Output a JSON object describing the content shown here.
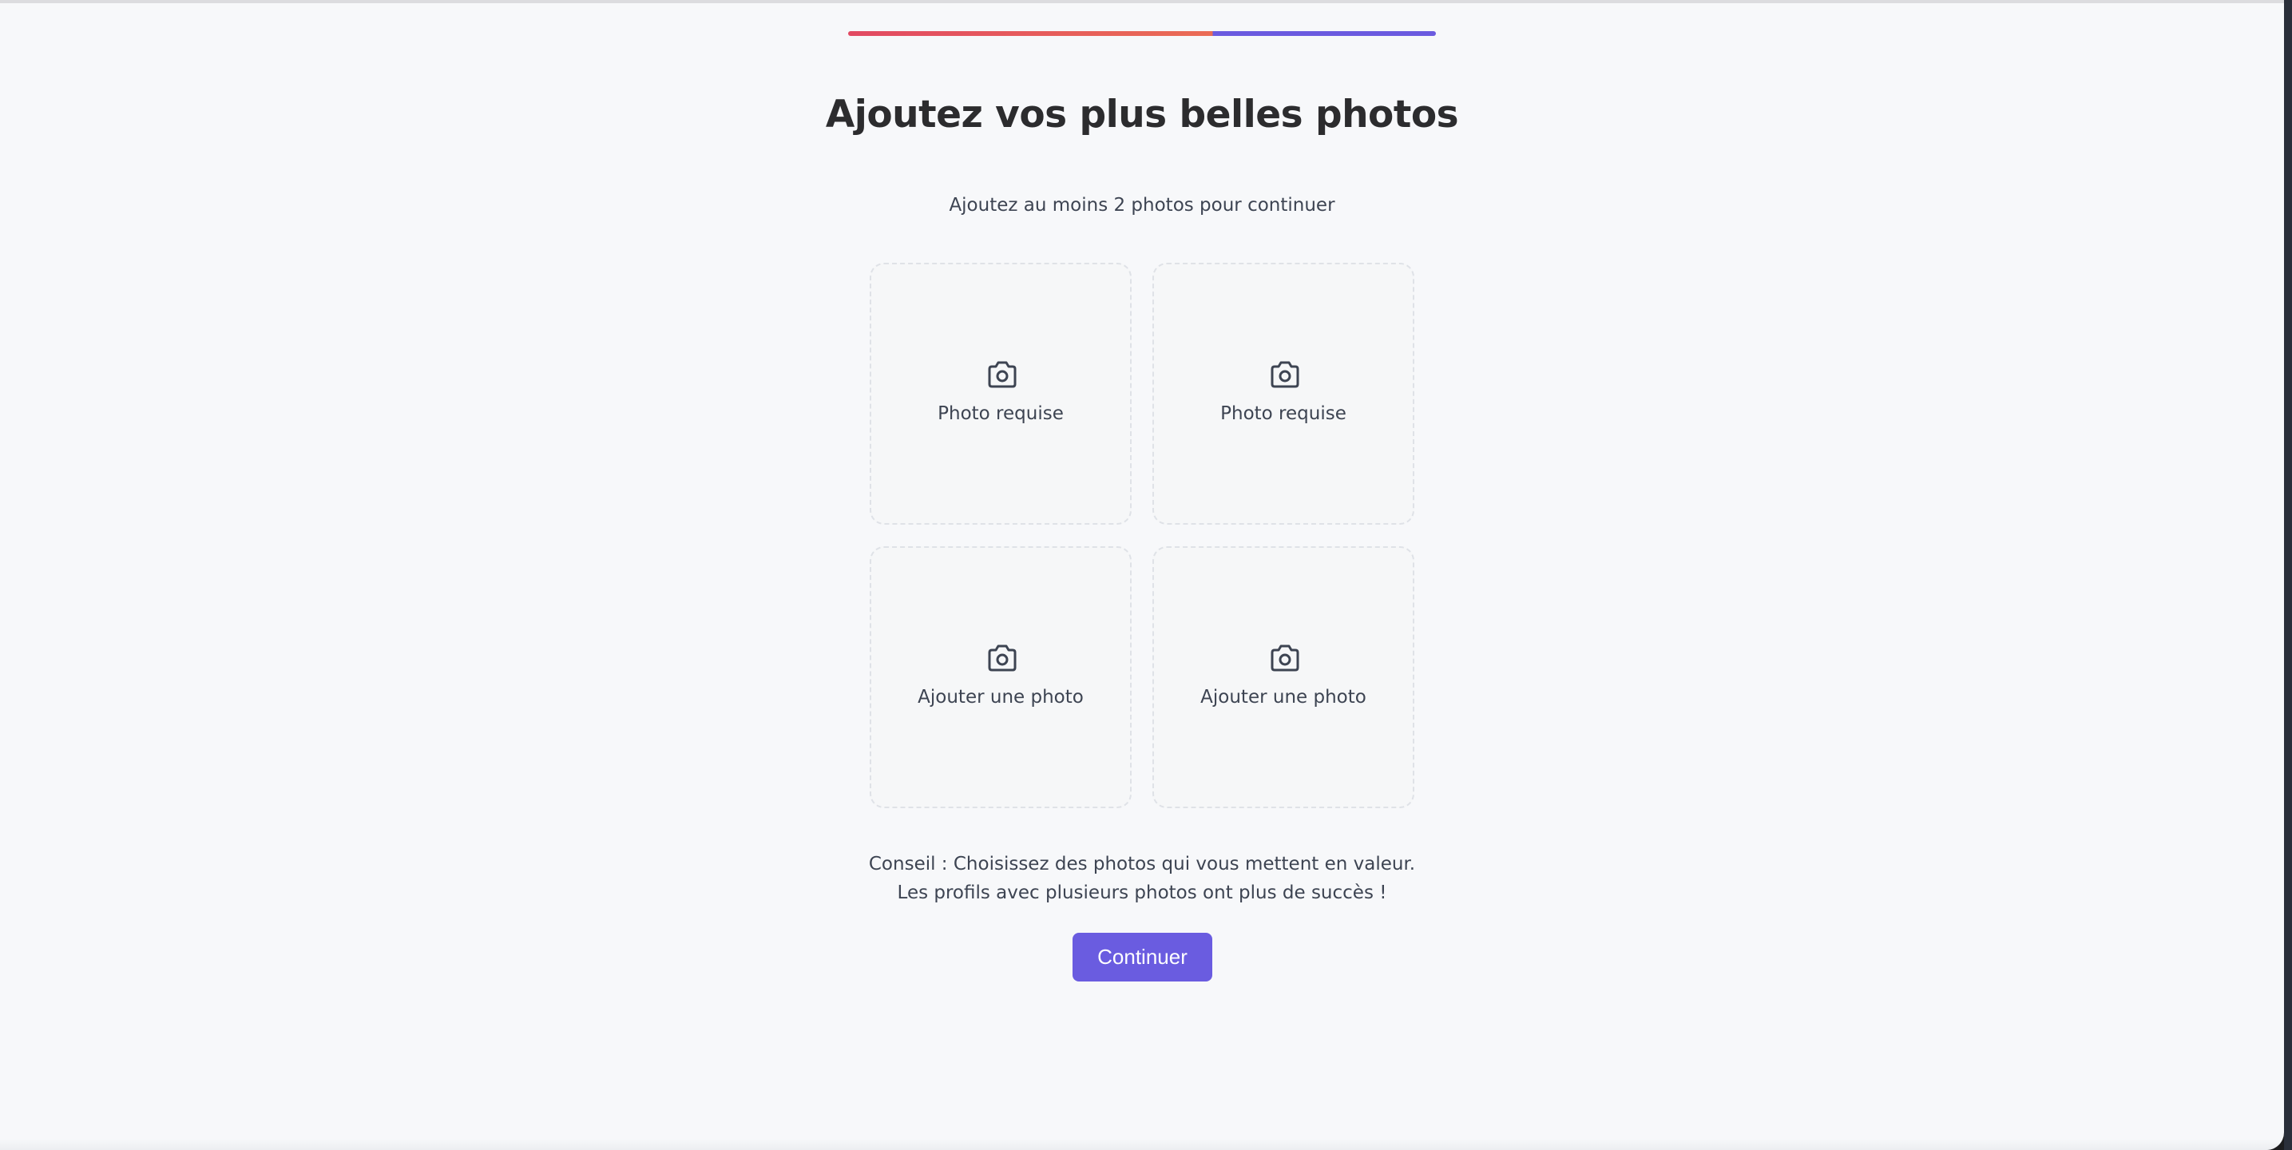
{
  "onboarding": {
    "progress_fraction": 0.62,
    "colors": {
      "progress_start": "#e24a62",
      "progress_mid": "#ea6c55",
      "progress_remaining": "#6b5bdf",
      "accent": "#6a5ce0"
    },
    "title": "Ajoutez vos plus belles photos",
    "subtitle": "Ajoutez au moins 2 photos pour continuer",
    "photo_slots": [
      {
        "label": "Photo requise",
        "icon": "camera-icon"
      },
      {
        "label": "Photo requise",
        "icon": "camera-icon"
      },
      {
        "label": "Ajouter une photo",
        "icon": "camera-icon"
      },
      {
        "label": "Ajouter une photo",
        "icon": "camera-icon"
      }
    ],
    "tip": "Conseil : Choisissez des photos qui vous mettent en valeur. Les profils avec plusieurs photos ont plus de succès !",
    "continue_label": "Continuer"
  }
}
